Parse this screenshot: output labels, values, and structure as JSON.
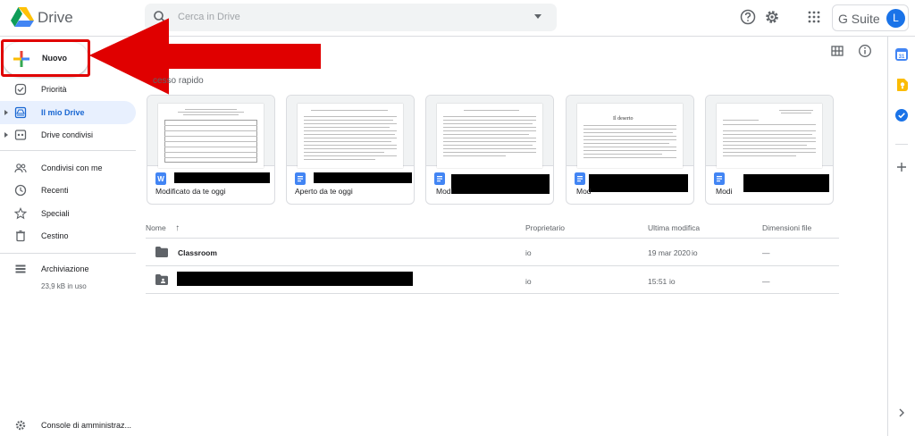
{
  "header": {
    "app_name": "Drive",
    "search_placeholder": "Cerca in Drive",
    "brand_label": "G Suite",
    "avatar_letter": "L"
  },
  "colors": {
    "accent": "#1a73e8",
    "active_bg": "#e8f0fe",
    "annotation_red": "#e00000"
  },
  "sidebar": {
    "new_label": "Nuovo",
    "items": [
      {
        "label": "Priorità",
        "icon": "check-circle-icon"
      },
      {
        "label": "Il mio Drive",
        "icon": "my-drive-icon",
        "active": true
      },
      {
        "label": "Drive condivisi",
        "icon": "shared-drives-icon"
      },
      {
        "label": "Condivisi con me",
        "icon": "people-icon"
      },
      {
        "label": "Recenti",
        "icon": "clock-icon"
      },
      {
        "label": "Speciali",
        "icon": "star-icon"
      },
      {
        "label": "Cestino",
        "icon": "trash-icon"
      },
      {
        "label": "Archiviazione",
        "icon": "storage-icon"
      }
    ],
    "storage_used": "23,9 kB in uso",
    "admin_console": "Console di amministraz..."
  },
  "quick_access": {
    "title": "cesso rapido",
    "cards": [
      {
        "subtitle": "Modificato da te oggi",
        "icon": "word-doc-icon"
      },
      {
        "subtitle": "Aperto da te oggi",
        "icon": "google-doc-icon"
      },
      {
        "subtitle": "Modi",
        "icon": "google-doc-icon"
      },
      {
        "subtitle": "Mod",
        "icon": "google-doc-icon"
      },
      {
        "subtitle": "Modi",
        "icon": "google-doc-icon"
      }
    ],
    "card4_page_heading": "Il deserto"
  },
  "files": {
    "columns": {
      "name": "Nome",
      "owner": "Proprietario",
      "modified": "Ultima modifica",
      "size": "Dimensioni file"
    },
    "rows": [
      {
        "name": "Classroom",
        "owner": "io",
        "modified": "19 mar 2020",
        "modified_by": "io",
        "size": "—"
      },
      {
        "name": "",
        "owner": "io",
        "modified": "15:51",
        "modified_by": "io",
        "size": "—"
      }
    ]
  }
}
